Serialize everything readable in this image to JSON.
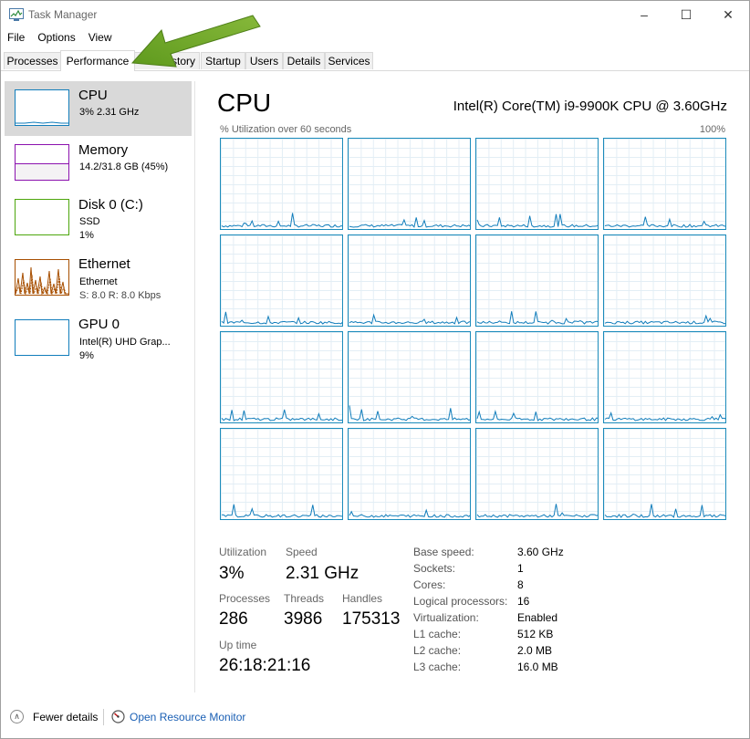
{
  "window": {
    "title": "Task Manager",
    "controls": {
      "minimize": "–",
      "maximize": "☐",
      "close": "✕"
    }
  },
  "menu": [
    "File",
    "Options",
    "View"
  ],
  "tabs": [
    {
      "label": "Processes",
      "active": false
    },
    {
      "label": "Performance",
      "active": true
    },
    {
      "label": "App history",
      "active": false,
      "visible_text": "istory"
    },
    {
      "label": "Startup",
      "active": false
    },
    {
      "label": "Users",
      "active": false
    },
    {
      "label": "Details",
      "active": false
    },
    {
      "label": "Services",
      "active": false
    }
  ],
  "sidebar": {
    "items": [
      {
        "title": "CPU",
        "line1": "3%  2.31 GHz",
        "line2": "",
        "color": "#117dbb",
        "active": true
      },
      {
        "title": "Memory",
        "line1": "14.2/31.8 GB (45%)",
        "line2": "",
        "color": "#8b12ae",
        "fill_percent": 45
      },
      {
        "title": "Disk 0 (C:)",
        "line1": "SSD",
        "line2": "1%",
        "color": "#4da60c"
      },
      {
        "title": "Ethernet",
        "line1": "Ethernet",
        "line2": "S: 8.0  R: 8.0 Kbps",
        "color": "#a74f01"
      },
      {
        "title": "GPU 0",
        "line1": "Intel(R) UHD Grap...",
        "line2": "9%",
        "color": "#117dbb"
      }
    ]
  },
  "main": {
    "heading": "CPU",
    "model": "Intel(R) Core(TM) i9-9900K CPU @ 3.60GHz",
    "graph_label": "% Utilization over 60 seconds",
    "graph_max": "100%",
    "core_count_graphs": 16,
    "line_color": "#117dbb"
  },
  "stats": {
    "utilization_label": "Utilization",
    "utilization": "3%",
    "speed_label": "Speed",
    "speed": "2.31 GHz",
    "processes_label": "Processes",
    "processes": "286",
    "threads_label": "Threads",
    "threads": "3986",
    "handles_label": "Handles",
    "handles": "175313",
    "uptime_label": "Up time",
    "uptime": "26:18:21:16"
  },
  "specs": [
    {
      "label": "Base speed:",
      "value": "3.60 GHz"
    },
    {
      "label": "Sockets:",
      "value": "1"
    },
    {
      "label": "Cores:",
      "value": "8"
    },
    {
      "label": "Logical processors:",
      "value": "16"
    },
    {
      "label": "Virtualization:",
      "value": "Enabled"
    },
    {
      "label": "L1 cache:",
      "value": "512 KB"
    },
    {
      "label": "L2 cache:",
      "value": "2.0 MB"
    },
    {
      "label": "L3 cache:",
      "value": "16.0 MB"
    }
  ],
  "footer": {
    "fewer_details": "Fewer details",
    "open_resource_monitor": "Open Resource Monitor"
  },
  "icons": {
    "app": "task-manager-icon",
    "fewer": "chevron-up-icon",
    "resmon": "resource-monitor-icon",
    "arrow": "green-arrow-icon"
  }
}
